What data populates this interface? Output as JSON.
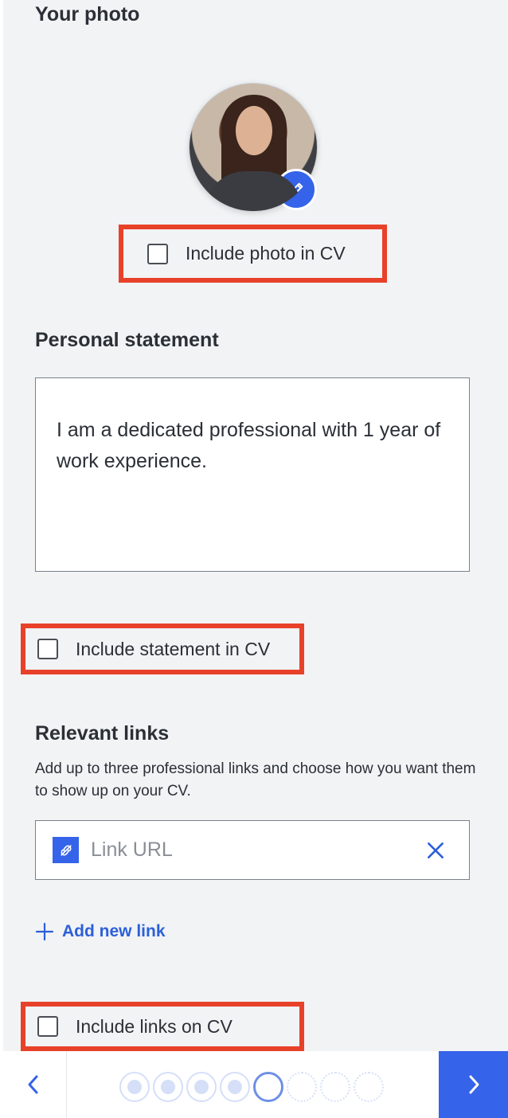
{
  "photo": {
    "heading": "Your photo",
    "include_label": "Include photo in CV"
  },
  "statement": {
    "heading": "Personal statement",
    "text": "I am a dedicated professional with 1 year of work experience.",
    "include_label": "Include statement in CV"
  },
  "links": {
    "heading": "Relevant links",
    "helper": "Add up to three professional links and choose how you want them to show up on your CV.",
    "url_placeholder": "Link URL",
    "add_label": "Add new link",
    "include_label": "Include links on CV"
  },
  "progress": {
    "completed_steps": 4,
    "current_step": 5,
    "total_steps": 8
  },
  "colors": {
    "accent": "#3563e9",
    "highlight": "#e8412a"
  },
  "icons": {
    "edit": "pencil-icon",
    "link": "link-icon",
    "clear": "close-icon",
    "add": "plus-icon",
    "prev": "chevron-left-icon",
    "next": "chevron-right-icon"
  }
}
